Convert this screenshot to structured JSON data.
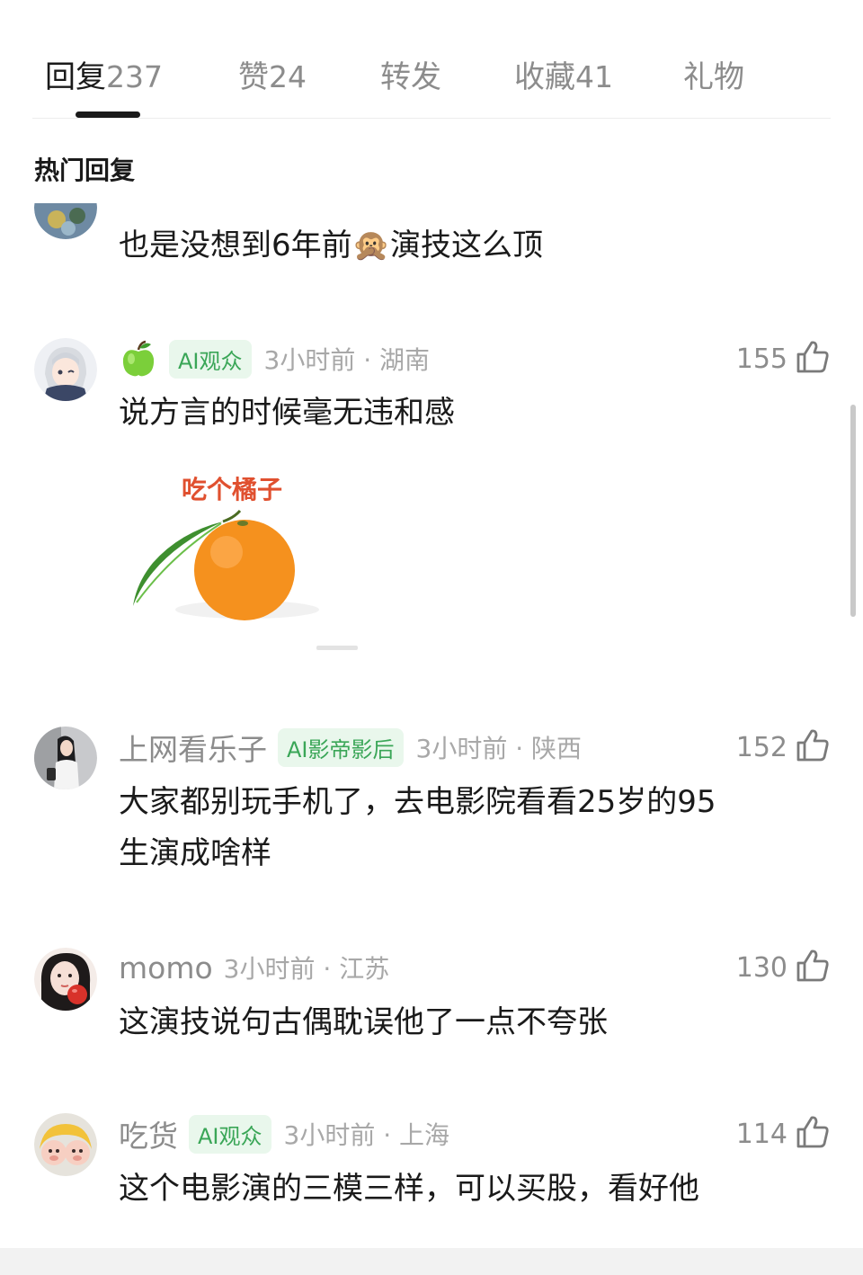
{
  "tabs": [
    {
      "label": "回复",
      "count": "237",
      "active": true
    },
    {
      "label": "赞",
      "count": "24",
      "active": false
    },
    {
      "label": "转发",
      "count": "",
      "active": false
    },
    {
      "label": "收藏",
      "count": "41",
      "active": false
    },
    {
      "label": "礼物",
      "count": "",
      "active": false
    }
  ],
  "section_title": "热门回复",
  "comments": [
    {
      "text_before_emoji": "也是没想到6年前",
      "emoji": "🙊",
      "text_after_emoji": "演技这么顶"
    },
    {
      "username": "",
      "user_icon": "green-apple-icon",
      "badge": "AI观众",
      "time_location": "3小时前 · 湖南",
      "likes": "155",
      "text": "说方言的时候毫无违和感",
      "sticker_text": "吃个橘子"
    },
    {
      "username": "上网看乐子",
      "badge": "AI影帝影后",
      "time_location": "3小时前 · 陕西",
      "likes": "152",
      "text_line1": "大家都别玩手机了，去电影院看看25岁的95",
      "text_line2": "生演成啥样"
    },
    {
      "username": "momo",
      "badge": "",
      "time_location": "3小时前 · 江苏",
      "likes": "130",
      "text": "这演技说句古偶耽误他了一点不夸张"
    },
    {
      "username": "吃货",
      "badge": "AI观众",
      "time_location": "3小时前 · 上海",
      "likes": "114",
      "text": "这个电影演的三模三样，可以买股，看好他"
    }
  ],
  "colors": {
    "accent_green": "#3aa657",
    "badge_bg": "#e9f7ec",
    "sticker_text": "#e0502f",
    "orange": "#f5911e"
  }
}
